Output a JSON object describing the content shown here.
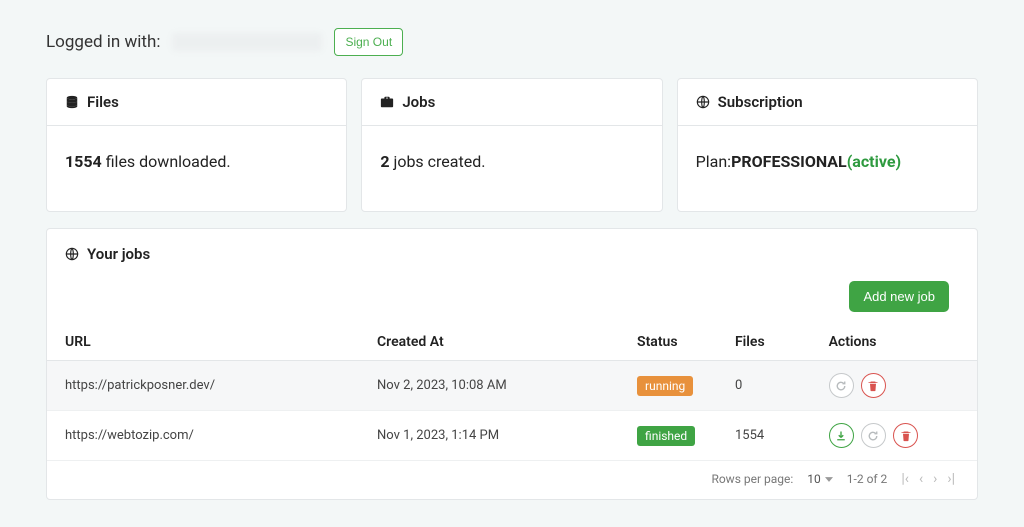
{
  "auth": {
    "logged_in_label": "Logged in with:",
    "sign_out_label": "Sign Out"
  },
  "files_card": {
    "title": "Files",
    "count": "1554",
    "suffix": " files downloaded."
  },
  "jobs_card": {
    "title": "Jobs",
    "count": "2",
    "suffix": " jobs created."
  },
  "subscription_card": {
    "title": "Subscription",
    "plan_label": "Plan:",
    "plan_name": "PROFESSIONAL",
    "status": "(active)"
  },
  "jobs_panel": {
    "title": "Your jobs",
    "add_button": "Add new job",
    "columns": {
      "url": "URL",
      "created": "Created At",
      "status": "Status",
      "files": "Files",
      "actions": "Actions"
    },
    "rows": [
      {
        "url": "https://patrickposner.dev/",
        "created_at": "Nov 2, 2023, 10:08 AM",
        "status": "running",
        "files": "0"
      },
      {
        "url": "https://webtozip.com/",
        "created_at": "Nov 1, 2023, 1:14 PM",
        "status": "finished",
        "files": "1554"
      }
    ],
    "pagination": {
      "rows_per_page_label": "Rows per page:",
      "rows_per_page_value": "10",
      "range": "1-2 of 2"
    }
  }
}
